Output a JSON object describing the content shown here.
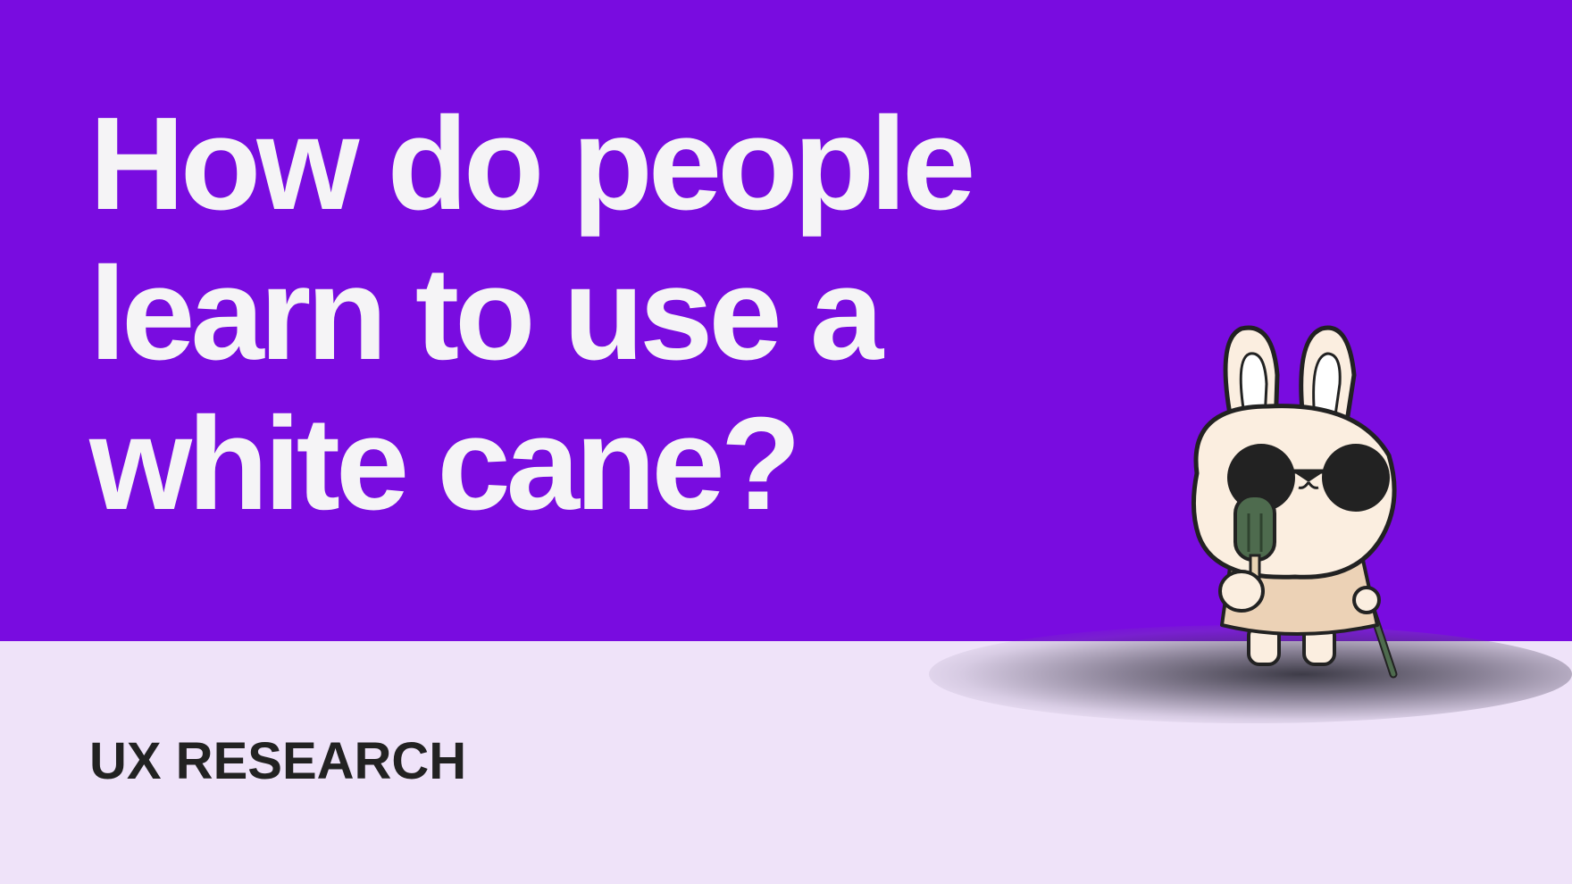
{
  "headline": {
    "line1": "How do people",
    "line2": "learn to use a",
    "line3": "white cane?"
  },
  "category": "UX RESEARCH",
  "colors": {
    "top_background": "#790CE0",
    "bottom_background": "#EFE3F9",
    "headline_text": "#F5F4F6",
    "category_text": "#222222"
  },
  "illustration": {
    "subject": "rabbit-mascot-with-sunglasses-and-white-cane-icon"
  }
}
